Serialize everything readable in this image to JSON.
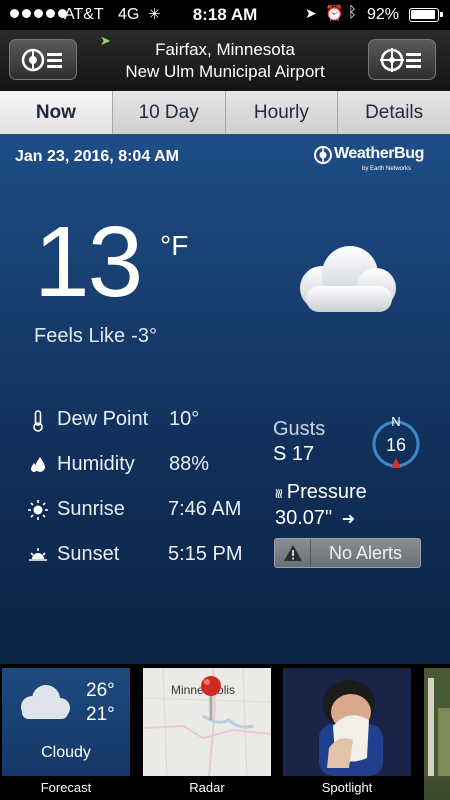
{
  "status_bar": {
    "carrier": "AT&T",
    "network": "4G",
    "time": "8:18 AM",
    "battery": "92%"
  },
  "header": {
    "location_line1": "Fairfax, Minnesota",
    "location_line2": "New Ulm Municipal Airport"
  },
  "tabs": [
    {
      "label": "Now",
      "active": true
    },
    {
      "label": "10 Day",
      "active": false
    },
    {
      "label": "Hourly",
      "active": false
    },
    {
      "label": "Details",
      "active": false
    }
  ],
  "current": {
    "datetime": "Jan 23, 2016, 8:04 AM",
    "brand": "WeatherBug",
    "brand_sub": "by Earth Networks",
    "temperature": "13",
    "unit": "°F",
    "feels_like_label": "Feels Like",
    "feels_like_value": "-3°",
    "condition_icon": "cloud-icon"
  },
  "details": {
    "dew_point_label": "Dew Point",
    "dew_point_value": "10°",
    "humidity_label": "Humidity",
    "humidity_value": "88%",
    "sunrise_label": "Sunrise",
    "sunrise_value": "7:46 AM",
    "sunset_label": "Sunset",
    "sunset_value": "5:15 PM",
    "gusts_label": "Gusts",
    "gusts_value": "S 17",
    "wind_direction": "N",
    "wind_speed": "16",
    "pressure_label": "Pressure",
    "pressure_value": "30.07\"",
    "pressure_trend_icon": "arrow-right-icon",
    "alerts_label": "No Alerts"
  },
  "cards": {
    "forecast": {
      "caption": "Forecast",
      "high": "26°",
      "low": "21°",
      "condition": "Cloudy"
    },
    "radar": {
      "caption": "Radar",
      "map_label": "Minneapolis"
    },
    "spotlight": {
      "caption": "Spotlight"
    }
  },
  "colors": {
    "main_bg_top": "#1e4d86",
    "main_bg_bottom": "#0b2444",
    "compass_ring": "#3f87c8",
    "compass_pointer": "#d8322a",
    "location_arrow": "#9fd25a"
  }
}
